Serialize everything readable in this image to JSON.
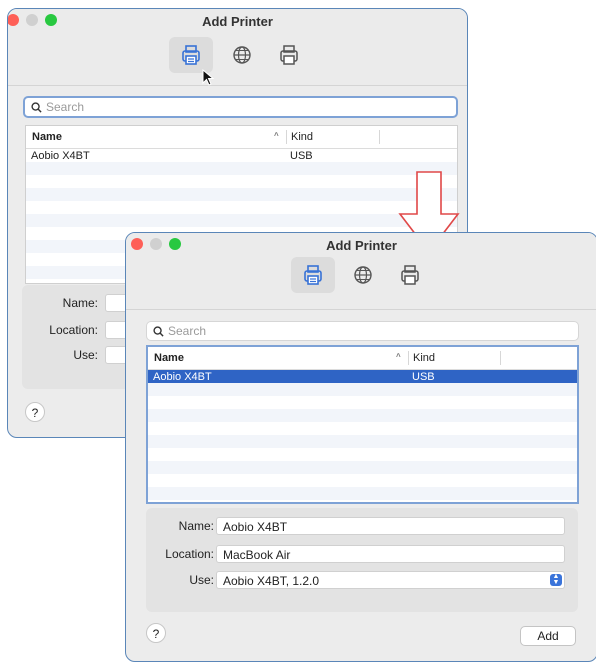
{
  "accent_color": "#2f64c5",
  "focus_color": "#7ea2d6",
  "window_before": {
    "title": "Add Printer",
    "toolbar": [
      {
        "icon": "printer-local-icon",
        "active": true
      },
      {
        "icon": "globe-ip-icon",
        "active": false
      },
      {
        "icon": "printer-windows-icon",
        "active": false
      }
    ],
    "search": {
      "placeholder": "Search"
    },
    "list": {
      "columns": [
        "Name",
        "Kind"
      ],
      "rows": [
        {
          "name": "Aobio X4BT",
          "kind": "USB",
          "selected": false
        }
      ]
    },
    "form": {
      "name_label": "Name:",
      "location_label": "Location:",
      "use_label": "Use:"
    },
    "help_label": "?"
  },
  "window_after": {
    "title": "Add Printer",
    "toolbar": [
      {
        "icon": "printer-local-icon",
        "active": true
      },
      {
        "icon": "globe-ip-icon",
        "active": false
      },
      {
        "icon": "printer-windows-icon",
        "active": false
      }
    ],
    "search": {
      "placeholder": "Search"
    },
    "list": {
      "columns": [
        "Name",
        "Kind"
      ],
      "rows": [
        {
          "name": "Aobio X4BT",
          "kind": "USB",
          "selected": true
        }
      ]
    },
    "form": {
      "name_label": "Name:",
      "name_value": "Aobio X4BT",
      "location_label": "Location:",
      "location_value": "MacBook Air",
      "use_label": "Use:",
      "use_value": "Aobio X4BT, 1.2.0"
    },
    "help_label": "?",
    "add_label": "Add"
  }
}
